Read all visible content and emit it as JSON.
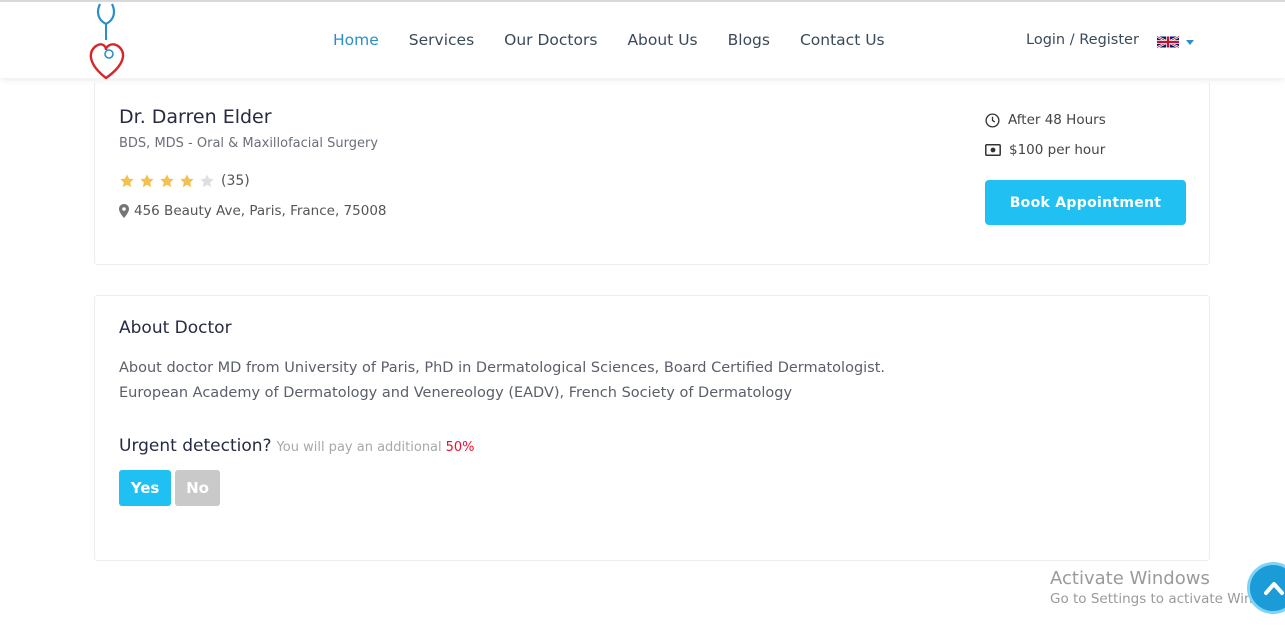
{
  "nav": {
    "items": [
      {
        "label": "Home",
        "active": true
      },
      {
        "label": "Services",
        "active": false
      },
      {
        "label": "Our Doctors",
        "active": false
      },
      {
        "label": "About Us",
        "active": false
      },
      {
        "label": "Blogs",
        "active": false
      },
      {
        "label": "Contact Us",
        "active": false
      }
    ],
    "login_label": "Login / Register",
    "language_icon": "uk-flag-icon"
  },
  "doctor": {
    "name": "Dr. Darren Elder",
    "specialty": "BDS, MDS - Oral & Maxillofacial Surgery",
    "rating": 4,
    "rating_max": 5,
    "rating_count": "(35)",
    "address": "456 Beauty Ave, Paris, France, 75008",
    "availability": "After 48 Hours",
    "price": "$100 per hour",
    "book_label": "Book Appointment"
  },
  "about": {
    "title": "About Doctor",
    "line1": "About doctor MD from University of Paris, PhD in Dermatological Sciences, Board Certified Dermatologist.",
    "line2": "European Academy of Dermatology and Venereology (EADV), French Society of Dermatology",
    "urgent_label": "Urgent detection?",
    "urgent_note": "You will pay an additional",
    "urgent_pct": "50%",
    "yes_label": "Yes",
    "no_label": "No"
  },
  "watermark": {
    "title": "Activate Windows",
    "subtitle": "Go to Settings to activate Windows."
  },
  "colors": {
    "accent": "#20c0f3",
    "nav_active": "#2a8ecb",
    "star": "#f4c150",
    "star_empty": "#dedfe0",
    "danger": "#e8122c"
  }
}
